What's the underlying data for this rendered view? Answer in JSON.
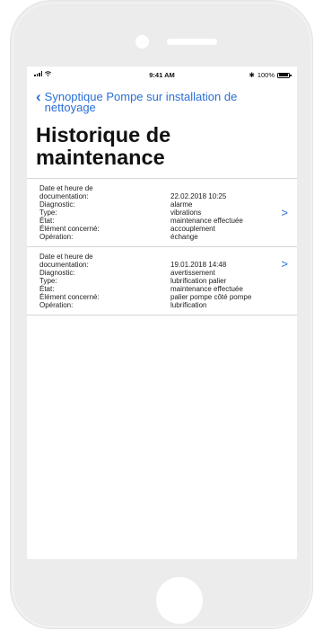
{
  "status_bar": {
    "time": "9:41 AM",
    "battery": "100%"
  },
  "navigation": {
    "back_label": "Synoptique Pompe sur installation de nettoyage",
    "title": "Historique de maintenance"
  },
  "records": [
    {
      "labels": [
        "Date et heure de",
        "documentation:",
        "Diagnostic:",
        "Type:",
        "État:",
        "Élément concerné:",
        "Opération:"
      ],
      "values": [
        "",
        "22.02.2018 10:25",
        "alarme",
        "vibrations",
        "maintenance effectuée",
        "accouplement",
        "échange"
      ]
    },
    {
      "labels": [
        "Date et heure de",
        "documentation:",
        "Diagnostic:",
        "Type:",
        "État:",
        "Élément concerné:",
        "Opération:"
      ],
      "values": [
        "",
        "19.01.2018 14:48",
        "avertissement",
        "lubrification palier",
        "maintenance effectuée",
        "palier pompe côté pompe",
        "lubrification"
      ]
    }
  ],
  "icons": {
    "back": "chevron-left-icon",
    "disclosure": "chevron-right-icon"
  },
  "colors": {
    "accent": "#2a6fd6",
    "phone_frame": "#ececec"
  }
}
